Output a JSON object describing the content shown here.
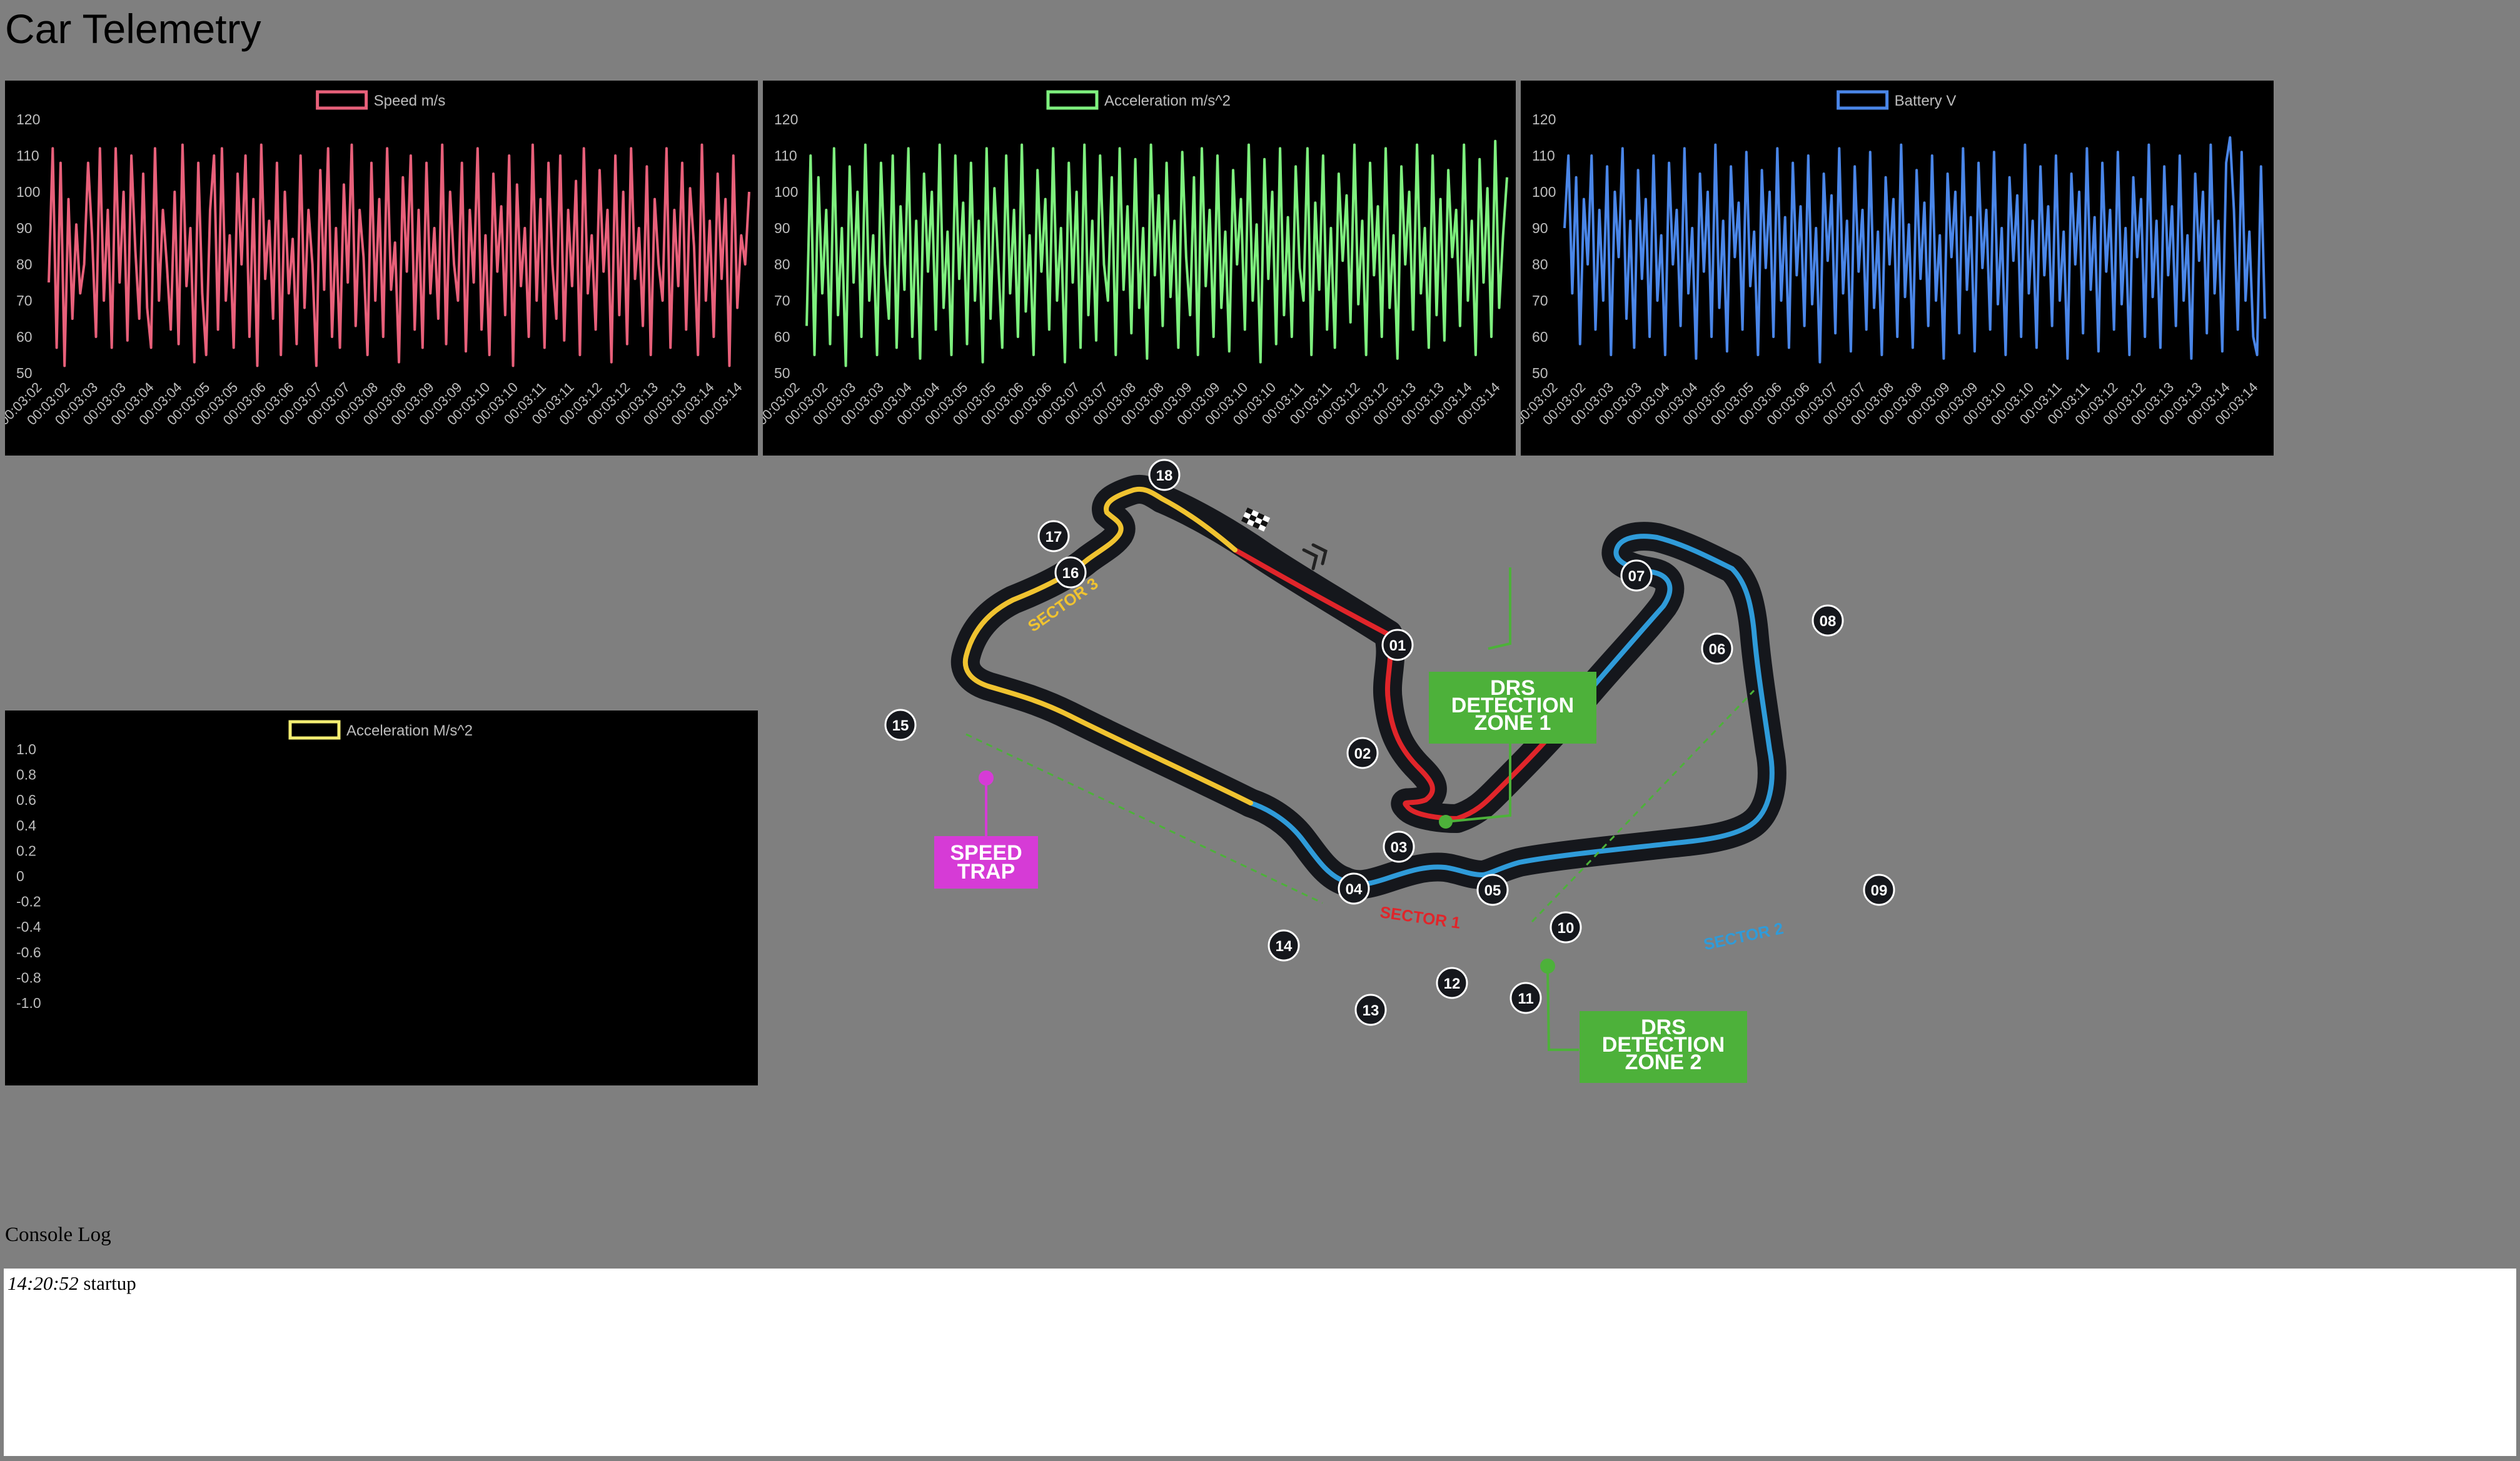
{
  "page": {
    "title": "Car Telemetry"
  },
  "console": {
    "label": "Console Log",
    "entries": [
      {
        "time": "14:20:52",
        "message": "startup"
      }
    ]
  },
  "track": {
    "sector_labels": [
      "SECTOR 1",
      "SECTOR 2",
      "SECTOR 3"
    ],
    "turns": [
      "01",
      "02",
      "03",
      "04",
      "05",
      "06",
      "07",
      "08",
      "09",
      "10",
      "11",
      "12",
      "13",
      "14",
      "15",
      "16",
      "17",
      "18"
    ],
    "callouts": {
      "drs1": [
        "DRS",
        "DETECTION",
        "ZONE 1"
      ],
      "drs2": [
        "DRS",
        "DETECTION",
        "ZONE 2"
      ],
      "speed_trap": [
        "SPEED",
        "TRAP"
      ]
    },
    "colors": {
      "sector1": "#e0252a",
      "sector2": "#2f9bd9",
      "sector3": "#f0c330",
      "drs": "#4db13a",
      "speed_trap": "#d63bd6"
    }
  },
  "chart_data": [
    {
      "type": "line",
      "series": [
        {
          "name": "Speed m/s",
          "color": "#e8607a",
          "values": [
            75,
            112,
            57,
            108,
            52,
            98,
            65,
            91,
            72,
            80,
            108,
            88,
            60,
            112,
            70,
            95,
            57,
            112,
            75,
            100,
            59,
            110,
            84,
            65,
            105,
            68,
            57,
            112,
            70,
            95,
            80,
            62,
            100,
            58,
            113,
            74,
            90,
            53,
            108,
            72,
            55,
            95,
            110,
            62,
            112,
            70,
            88,
            57,
            105,
            80,
            110,
            60,
            98,
            52,
            113,
            76,
            92,
            65,
            108,
            55,
            100,
            72,
            87,
            58,
            110,
            68,
            95,
            80,
            52,
            106,
            73,
            112,
            60,
            90,
            57,
            102,
            75,
            113,
            63,
            95,
            82,
            55,
            108,
            70,
            98,
            60,
            112,
            73,
            86,
            53,
            104,
            78,
            110,
            62,
            95,
            57,
            108,
            72,
            90,
            65,
            113,
            58,
            100,
            80,
            70,
            108,
            56,
            95,
            75,
            112,
            62,
            88,
            55,
            105,
            78,
            96,
            66,
            110,
            52,
            102,
            74,
            90,
            60,
            113,
            70,
            98,
            57,
            108,
            80,
            65,
            110,
            59,
            95,
            74,
            103,
            55,
            112,
            72,
            88,
            62,
            106,
            78,
            95,
            53,
            110,
            66,
            100,
            58,
            112,
            76,
            90,
            63,
            107,
            55,
            98,
            80,
            70,
            112,
            57,
            95,
            74,
            108,
            62,
            101,
            85,
            55,
            113,
            70,
            92,
            60,
            105,
            76,
            98,
            52,
            110,
            68,
            88,
            80,
            100
          ]
        }
      ],
      "x_tick_labels": [
        "00:03:02",
        "00:03:02",
        "00:03:03",
        "00:03:03",
        "00:03:04",
        "00:03:04",
        "00:03:05",
        "00:03:05",
        "00:03:06",
        "00:03:06",
        "00:03:07",
        "00:03:07",
        "00:03:08",
        "00:03:08",
        "00:03:09",
        "00:03:09",
        "00:03:10",
        "00:03:10",
        "00:03:11",
        "00:03:11",
        "00:03:12",
        "00:03:12",
        "00:03:13",
        "00:03:13",
        "00:03:14",
        "00:03:14"
      ],
      "y_ticks": [
        120,
        110,
        100,
        90,
        80,
        70,
        60,
        50
      ],
      "ylim": [
        50,
        120
      ]
    },
    {
      "type": "line",
      "series": [
        {
          "name": "Acceleration m/s^2",
          "color": "#7ef07e",
          "values": [
            63,
            110,
            55,
            104,
            72,
            95,
            58,
            112,
            66,
            90,
            52,
            107,
            75,
            100,
            60,
            113,
            70,
            88,
            55,
            108,
            80,
            65,
            110,
            57,
            96,
            73,
            112,
            60,
            92,
            54,
            105,
            78,
            100,
            62,
            113,
            68,
            89,
            55,
            110,
            76,
            97,
            58,
            108,
            70,
            92,
            53,
            112,
            65,
            101,
            80,
            57,
            110,
            72,
            95,
            60,
            113,
            67,
            88,
            55,
            106,
            78,
            98,
            62,
            112,
            70,
            90,
            53,
            108,
            75,
            100,
            57,
            113,
            66,
            92,
            59,
            110,
            80,
            70,
            104,
            55,
            112,
            73,
            96,
            61,
            109,
            68,
            90,
            54,
            113,
            77,
            99,
            63,
            108,
            71,
            92,
            57,
            111,
            82,
            66,
            104,
            55,
            112,
            74,
            95,
            60,
            110,
            68,
            89,
            56,
            106,
            80,
            98,
            62,
            113,
            70,
            91,
            53,
            109,
            76,
            100,
            58,
            112,
            66,
            93,
            60,
            107,
            79,
            70,
            112,
            55,
            97,
            73,
            110,
            62,
            90,
            57,
            105,
            81,
            99,
            64,
            113,
            69,
            92,
            55,
            108,
            77,
            96,
            60,
            112,
            68,
            88,
            54,
            107,
            80,
            100,
            62,
            113,
            72,
            90,
            57,
            110,
            66,
            98,
            59,
            106,
            82,
            95,
            63,
            113,
            70,
            92,
            55,
            109,
            75,
            101,
            60,
            114,
            68,
            88,
            104
          ]
        }
      ],
      "x_tick_labels": [
        "00:03:02",
        "00:03:02",
        "00:03:03",
        "00:03:03",
        "00:03:04",
        "00:03:04",
        "00:03:05",
        "00:03:05",
        "00:03:06",
        "00:03:06",
        "00:03:07",
        "00:03:07",
        "00:03:08",
        "00:03:08",
        "00:03:09",
        "00:03:09",
        "00:03:10",
        "00:03:10",
        "00:03:11",
        "00:03:11",
        "00:03:12",
        "00:03:12",
        "00:03:13",
        "00:03:13",
        "00:03:14",
        "00:03:14"
      ],
      "y_ticks": [
        120,
        110,
        100,
        90,
        80,
        70,
        60,
        50
      ],
      "ylim": [
        50,
        120
      ]
    },
    {
      "type": "line",
      "series": [
        {
          "name": "Battery V",
          "color": "#4a86e8",
          "values": [
            90,
            110,
            72,
            104,
            58,
            98,
            80,
            110,
            62,
            95,
            70,
            107,
            55,
            100,
            82,
            112,
            65,
            92,
            57,
            106,
            76,
            98,
            60,
            110,
            70,
            88,
            55,
            108,
            80,
            95,
            63,
            112,
            72,
            90,
            54,
            105,
            78,
            100,
            60,
            113,
            68,
            92,
            56,
            107,
            82,
            97,
            62,
            111,
            74,
            89,
            55,
            106,
            79,
            100,
            60,
            112,
            70,
            93,
            57,
            108,
            77,
            96,
            63,
            110,
            69,
            90,
            53,
            105,
            81,
            99,
            61,
            112,
            72,
            92,
            56,
            107,
            78,
            95,
            62,
            111,
            68,
            89,
            55,
            104,
            80,
            98,
            60,
            113,
            71,
            91,
            57,
            106,
            76,
            97,
            63,
            110,
            70,
            88,
            54,
            105,
            82,
            100,
            61,
            112,
            73,
            93,
            56,
            108,
            79,
            95,
            62,
            111,
            69,
            90,
            55,
            104,
            81,
            99,
            60,
            113,
            72,
            92,
            57,
            107,
            77,
            96,
            63,
            110,
            70,
            89,
            54,
            105,
            80,
            100,
            61,
            112,
            73,
            93,
            56,
            108,
            78,
            95,
            62,
            111,
            69,
            90,
            55,
            104,
            82,
            98,
            60,
            113,
            71,
            92,
            57,
            107,
            77,
            96,
            63,
            110,
            70,
            88,
            54,
            105,
            81,
            100,
            61,
            113,
            72,
            92,
            56,
            108,
            115,
            95,
            62,
            111,
            70,
            89,
            60,
            55,
            107,
            65
          ]
        }
      ],
      "x_tick_labels": [
        "00:03:02",
        "00:03:02",
        "00:03:03",
        "00:03:03",
        "00:03:04",
        "00:03:04",
        "00:03:05",
        "00:03:05",
        "00:03:06",
        "00:03:06",
        "00:03:07",
        "00:03:07",
        "00:03:08",
        "00:03:08",
        "00:03:09",
        "00:03:09",
        "00:03:10",
        "00:03:10",
        "00:03:11",
        "00:03:11",
        "00:03:12",
        "00:03:12",
        "00:03:13",
        "00:03:13",
        "00:03:14",
        "00:03:14"
      ],
      "y_ticks": [
        120,
        110,
        100,
        90,
        80,
        70,
        60,
        50
      ],
      "ylim": [
        50,
        120
      ]
    },
    {
      "type": "line",
      "series": [
        {
          "name": "Acceleration M/s^2",
          "color": "#f4ee72",
          "values": []
        }
      ],
      "x_tick_labels": [],
      "y_ticks": [
        "1.0",
        "0.8",
        "0.6",
        "0.4",
        "0.2",
        "0",
        "-0.2",
        "-0.4",
        "-0.6",
        "-0.8",
        "-1.0"
      ],
      "ylim": [
        -1,
        1
      ]
    }
  ]
}
